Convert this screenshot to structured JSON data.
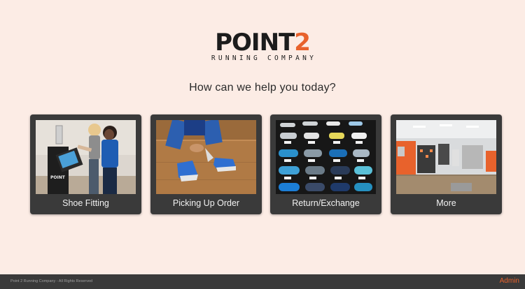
{
  "brand": {
    "logo_main": "P",
    "logo_main_rest": "OINT",
    "logo_number": "2",
    "logo_sub": "RUNNING COMPANY",
    "accent_color": "#e8622c"
  },
  "prompt": {
    "question": "How can we help you today?"
  },
  "options": [
    {
      "label": "Shoe Fitting",
      "image": "shoe-fitting-photo"
    },
    {
      "label": "Picking Up Order",
      "image": "picking-up-order-photo"
    },
    {
      "label": "Return/Exchange",
      "image": "return-exchange-photo"
    },
    {
      "label": "More",
      "image": "store-interior-photo"
    }
  ],
  "footer": {
    "copyright": "Point 2 Running Company - All Rights Reserved",
    "admin_link": "Admin"
  },
  "colors": {
    "background": "#fcece5",
    "card": "#3a3a3a",
    "footer": "#3a3a3a"
  }
}
